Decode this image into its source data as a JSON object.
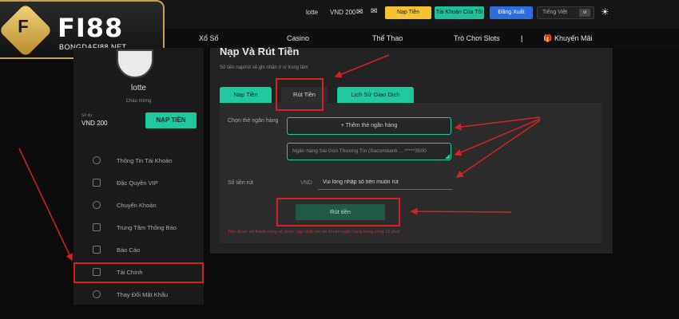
{
  "header": {
    "username": "lotte",
    "balance": "VND 200",
    "deposit_button": "Nạp Tiền",
    "account_button": "Tài Khoản Của Tôi",
    "logout_button": "Đăng Xuất",
    "language": "Tiếng Việt",
    "language_code": "vi"
  },
  "logo": {
    "brand": "FI88",
    "emblem": "F",
    "domain": "BONGDAFI88.NET"
  },
  "nav": {
    "items": [
      "Xổ Số",
      "Casino",
      "Thể Thao",
      "Trò Chơi Slots",
      "Khuyến Mãi"
    ]
  },
  "sidebar": {
    "name": "lotte",
    "welcome": "Chào mừng",
    "balance_label": "Số dư",
    "balance_value": "VND 200",
    "deposit_button": "NẠP TIỀN",
    "items": [
      {
        "label": "Thông Tin Tài Khoản"
      },
      {
        "label": "Đặc Quyền VIP"
      },
      {
        "label": "Chuyển Khoản"
      },
      {
        "label": "Trung Tâm Thông Báo"
      },
      {
        "label": "Báo Cáo"
      },
      {
        "label": "Tài Chính"
      },
      {
        "label": "Thay Đổi Mật Khẩu"
      }
    ]
  },
  "main": {
    "title": "Nạp Và Rút Tiền",
    "subtitle": "Số tiền nạp/rút sẽ ghi nhận ở ví trung tâm",
    "tabs": [
      "Nạp Tiền",
      "Rút Tiền",
      "Lịch Sử Giao Dịch"
    ],
    "bank_label": "Chọn thẻ ngân hàng",
    "add_bank": "+ Thêm thẻ ngân hàng",
    "bank_selected": "Ngân hàng Sài Gòn Thương Tín (Sacombank ... *****3500",
    "amount_label": "Số tiền rút",
    "currency": "VND",
    "amount_placeholder": "Vui lòng nhập số tiền muốn rút",
    "withdraw_button": "Rút tiền",
    "note": "Tiền được rút thành công sẽ được cập nhật vào tài khoản ngân hàng trong vòng 15 phút"
  },
  "colors": {
    "accent": "#1fc9a0",
    "annotation": "#d32222",
    "deposit": "#f4c430",
    "logout": "#2e6edc"
  }
}
